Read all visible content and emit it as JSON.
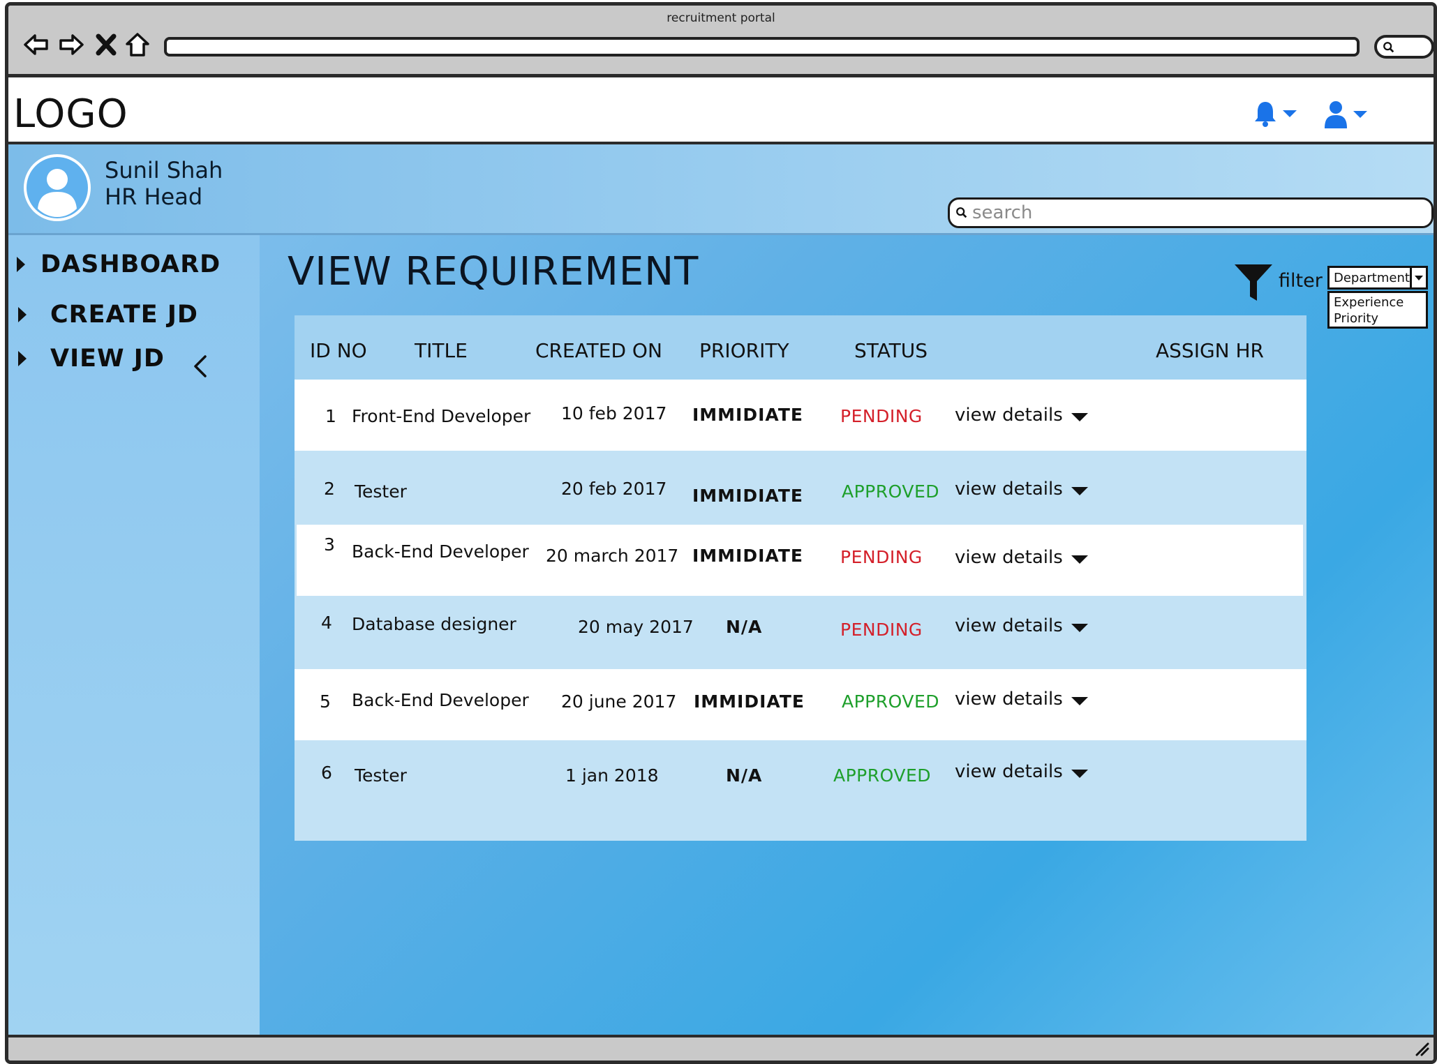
{
  "window": {
    "title": "recruitment portal"
  },
  "header": {
    "logo": "LOGO"
  },
  "user": {
    "name": "Sunil Shah",
    "role": "HR Head"
  },
  "search": {
    "placeholder": "search"
  },
  "sidebar": {
    "items": [
      {
        "label": "DASHBOARD"
      },
      {
        "label": "CREATE JD"
      },
      {
        "label": "VIEW JD"
      }
    ]
  },
  "main": {
    "title": "VIEW REQUIREMENT",
    "filter": {
      "label": "filter",
      "selected": "Department",
      "options": [
        "Experience",
        "Priority"
      ]
    },
    "table": {
      "columns": [
        "ID NO",
        "TITLE",
        "CREATED ON",
        "PRIORITY",
        "STATUS",
        "ASSIGN HR"
      ],
      "rows": [
        {
          "id": "1",
          "title": "Front-End Developer",
          "created": "10 feb 2017",
          "priority": "IMMIDIATE",
          "status": "PENDING",
          "details": "view details"
        },
        {
          "id": "2",
          "title": "Tester",
          "created": "20 feb 2017",
          "priority": "IMMIDIATE",
          "status": "APPROVED",
          "details": "view details"
        },
        {
          "id": "3",
          "title": "Back-End Developer",
          "created": "20 march 2017",
          "priority": "IMMIDIATE",
          "status": "PENDING",
          "details": "view details"
        },
        {
          "id": "4",
          "title": "Database designer",
          "created": "20 may 2017",
          "priority": "N/A",
          "status": "PENDING",
          "details": "view details"
        },
        {
          "id": "5",
          "title": "Back-End Developer",
          "created": "20 june 2017",
          "priority": "IMMIDIATE",
          "status": "APPROVED",
          "details": "view details"
        },
        {
          "id": "6",
          "title": "Tester",
          "created": "1 jan 2018",
          "priority": "N/A",
          "status": "APPROVED",
          "details": "view details"
        }
      ]
    }
  },
  "colors": {
    "pending": "#d4202a",
    "approved": "#1e9f2b",
    "icon_blue": "#1a73e8"
  },
  "icons": [
    "back-arrow-icon",
    "forward-arrow-icon",
    "close-icon",
    "home-icon",
    "search-icon",
    "bell-icon",
    "user-icon",
    "filter-icon",
    "chevron-left-icon",
    "caret-down-icon",
    "resize-grip-icon"
  ]
}
